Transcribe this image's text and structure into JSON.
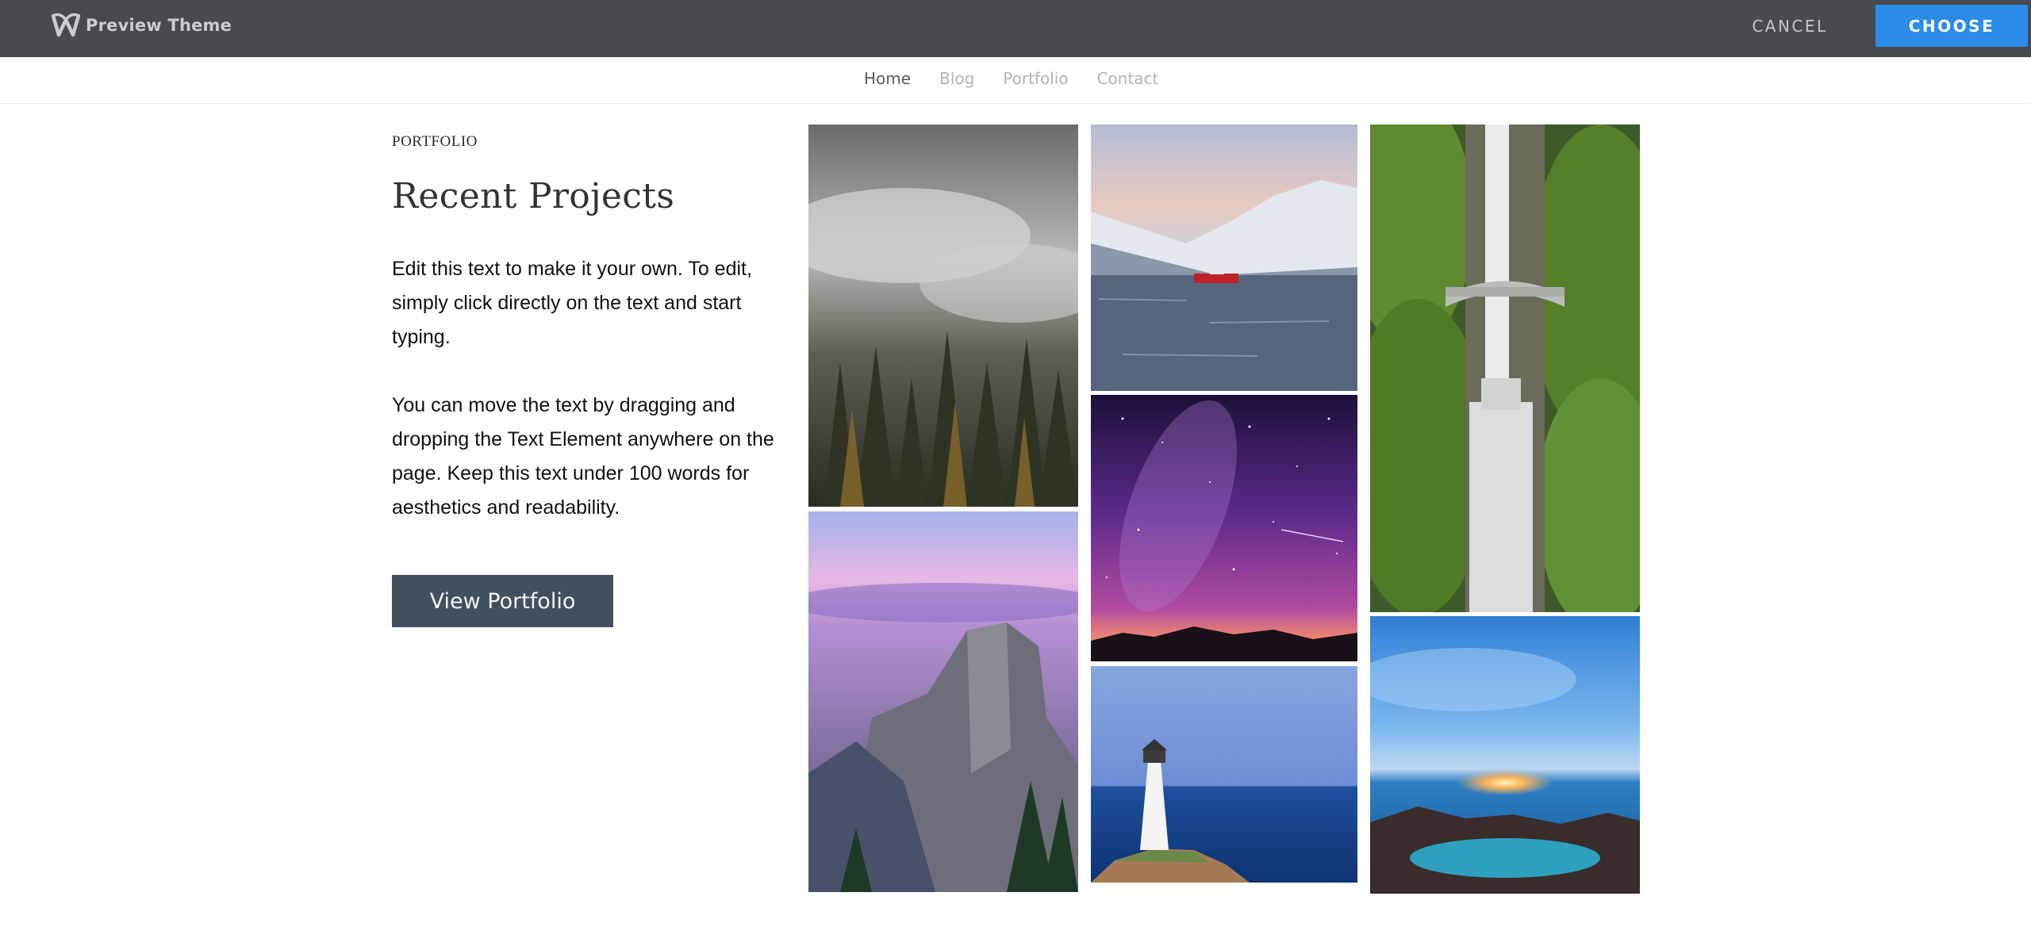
{
  "preview_bar": {
    "brand_name": "Preview Theme",
    "brand_icon": "weebly-w-logo-icon",
    "cancel_label": "CANCEL",
    "choose_label": "CHOOSE",
    "accent_color": "#2b8de9",
    "bar_color": "#464b50"
  },
  "site_nav": {
    "items": [
      {
        "label": "Home",
        "active": true
      },
      {
        "label": "Blog",
        "active": false
      },
      {
        "label": "Portfolio",
        "active": false
      },
      {
        "label": "Contact",
        "active": false
      }
    ]
  },
  "intro": {
    "eyebrow": "PORTFOLIO",
    "heading": "Recent Projects",
    "paragraph_1": "Edit this text to make it your own. To edit, simply click directly on the text and start typing.",
    "paragraph_2": "You can move the text by dragging and dropping the Text Element anywhere on the page. Keep this text under 100 words for aesthetics and readability.",
    "button_label": "View Portfolio",
    "button_color": "#424f5e"
  },
  "gallery": {
    "photos": [
      {
        "subject": "foggy-forest-photo"
      },
      {
        "subject": "half-dome-sunset-photo"
      },
      {
        "subject": "boat-snowy-fjord-photo"
      },
      {
        "subject": "milky-way-night-sky-photo"
      },
      {
        "subject": "lighthouse-sea-photo"
      },
      {
        "subject": "waterfall-bridge-photo"
      },
      {
        "subject": "ocean-sunset-rocks-photo"
      }
    ]
  }
}
